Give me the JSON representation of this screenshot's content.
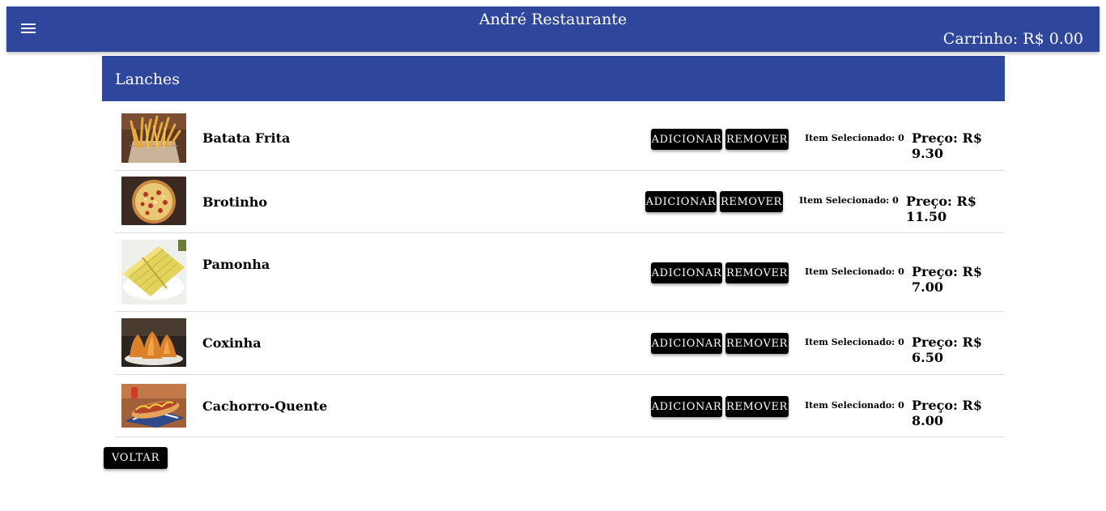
{
  "app": {
    "title": "André Restaurante",
    "cart_label": "Carrinho: R$ 0.00"
  },
  "category": {
    "title": "Lanches"
  },
  "buttons": {
    "add": "ADICIONAR",
    "remove": "REMOVER",
    "back": "VOLTAR"
  },
  "products": [
    {
      "name": "Batata Frita",
      "selected": "Item Selecionado: 0",
      "price": "Preço: R$ 9.30",
      "image": "fries-image"
    },
    {
      "name": "Brotinho",
      "selected": "Item Selecionado: 0",
      "price": "Preço: R$ 11.50",
      "image": "pizza-image"
    },
    {
      "name": "Pamonha",
      "selected": "Item Selecionado: 0",
      "price": "Preço: R$ 7.00",
      "image": "pamonha-image"
    },
    {
      "name": "Coxinha",
      "selected": "Item Selecionado: 0",
      "price": "Preço: R$ 6.50",
      "image": "coxinha-image"
    },
    {
      "name": "Cachorro-Quente",
      "selected": "Item Selecionado: 0",
      "price": "Preço: R$ 8.00",
      "image": "hotdog-image"
    }
  ],
  "colors": {
    "primary": "#2e479c",
    "button": "#000000",
    "divider": "#dcdcdc"
  }
}
